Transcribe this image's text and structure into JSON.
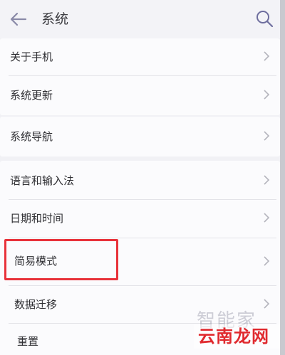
{
  "header": {
    "title": "系统"
  },
  "groups": [
    {
      "items": [
        {
          "label": "关于手机"
        },
        {
          "label": "系统更新"
        }
      ]
    },
    {
      "items": [
        {
          "label": "系统导航"
        }
      ]
    },
    {
      "items": [
        {
          "label": "语言和输入法"
        },
        {
          "label": "日期和时间"
        },
        {
          "label": "简易模式"
        },
        {
          "label": "数据迁移"
        },
        {
          "label": "重置"
        }
      ]
    }
  ],
  "watermark": {
    "top": "智能家",
    "bottom": "云南龙网"
  },
  "colors": {
    "highlight": "#e8323a",
    "watermark_red": "#e02a2f"
  }
}
